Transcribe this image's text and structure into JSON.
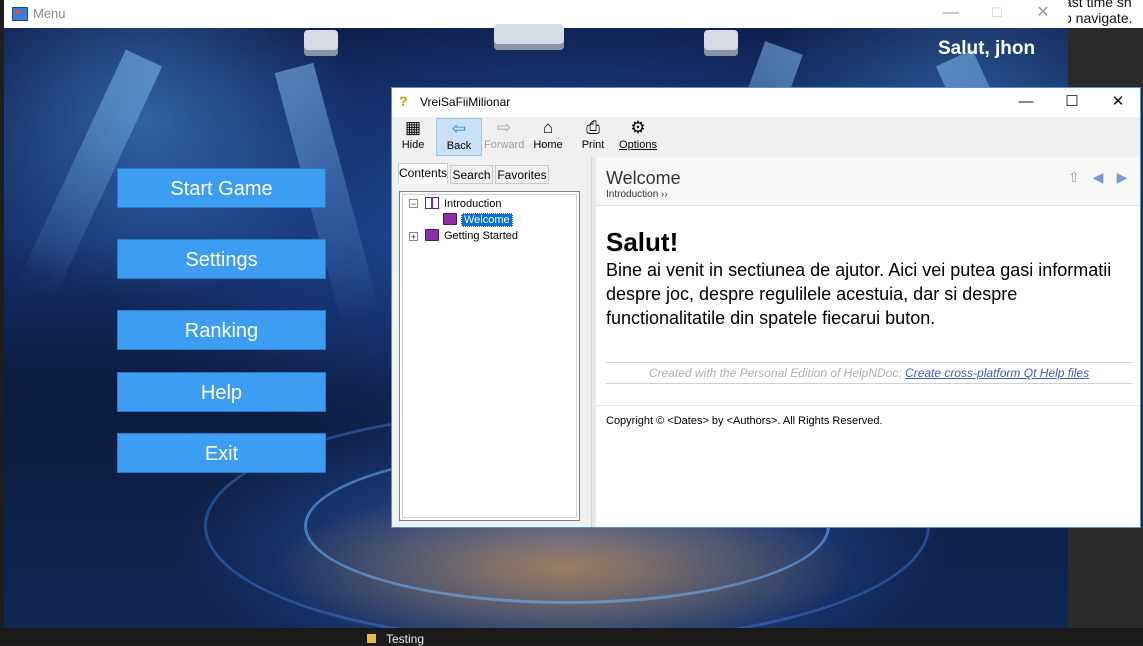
{
  "background": {
    "right_text_line1": "ast time sh",
    "right_text_line2": "o navigate.",
    "taskbar_item": "Testing"
  },
  "menu_window": {
    "title": "Menu",
    "greeting": "Salut, jhon",
    "buttons": [
      "Start Game",
      "Settings",
      "Ranking",
      "Help",
      "Exit"
    ]
  },
  "help_window": {
    "title": "VreiSaFiiMilionar",
    "toolbar": [
      {
        "label": "Hide",
        "icon": "hide-icon"
      },
      {
        "label": "Back",
        "icon": "back-arrow-icon"
      },
      {
        "label": "Forward",
        "icon": "forward-arrow-icon"
      },
      {
        "label": "Home",
        "icon": "home-icon"
      },
      {
        "label": "Print",
        "icon": "printer-icon"
      },
      {
        "label": "Options",
        "icon": "options-icon"
      }
    ],
    "tabs": [
      "Contents",
      "Search",
      "Favorites"
    ],
    "tree": {
      "introduction": "Introduction",
      "welcome": "Welcome",
      "getting_started": "Getting Started"
    },
    "content": {
      "header_title": "Welcome",
      "breadcrumb": "Introduction ››",
      "heading": "Salut!",
      "body": "Bine ai venit in sectiunea de ajutor. Aici vei putea gasi informatii despre joc, despre regulilele acestuia, dar si despre functionalitatile din spatele fiecarui buton.",
      "created_prefix": "Created with the Personal Edition of HelpNDoc: ",
      "created_link": "Create cross-platform Qt Help files",
      "copyright": "Copyright © <Dates> by <Authors>. All Rights Reserved."
    }
  },
  "colors": {
    "menu_button": "#3d9df3",
    "selection": "#0a6fd8",
    "link": "#3a5bd0"
  }
}
